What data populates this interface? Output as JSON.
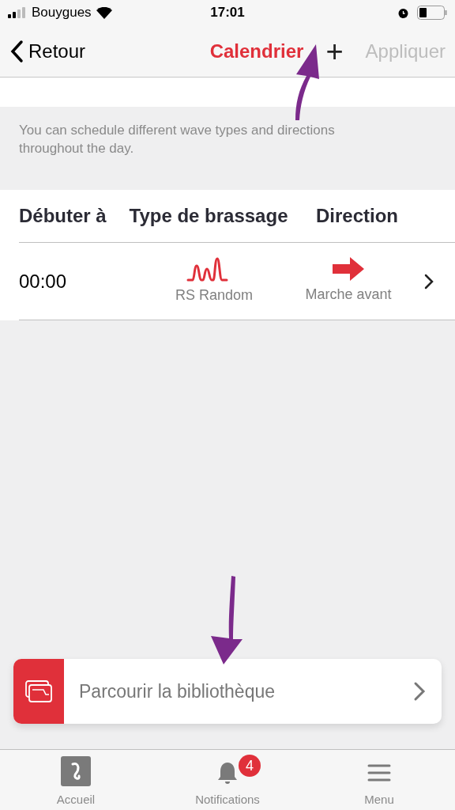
{
  "status_bar": {
    "carrier": "Bouygues",
    "time": "17:01"
  },
  "nav": {
    "back": "Retour",
    "title": "Calendrier",
    "add": "+",
    "apply": {
      "label": "Appliquer",
      "disabled": true
    }
  },
  "info": "You can schedule different wave types and directions throughout the day.",
  "table": {
    "columns": [
      "Débuter à",
      "Type de brassage",
      "Direction"
    ],
    "rows": [
      {
        "start": "00:00",
        "wave": "RS Random",
        "direction": "Marche avant"
      }
    ]
  },
  "library": {
    "label": "Parcourir la bibliothèque"
  },
  "tab_bar": [
    {
      "kind": "home",
      "label": "Accueil"
    },
    {
      "kind": "notifications",
      "label": "Notifications",
      "badge": "4"
    },
    {
      "kind": "menu",
      "label": "Menu"
    }
  ]
}
